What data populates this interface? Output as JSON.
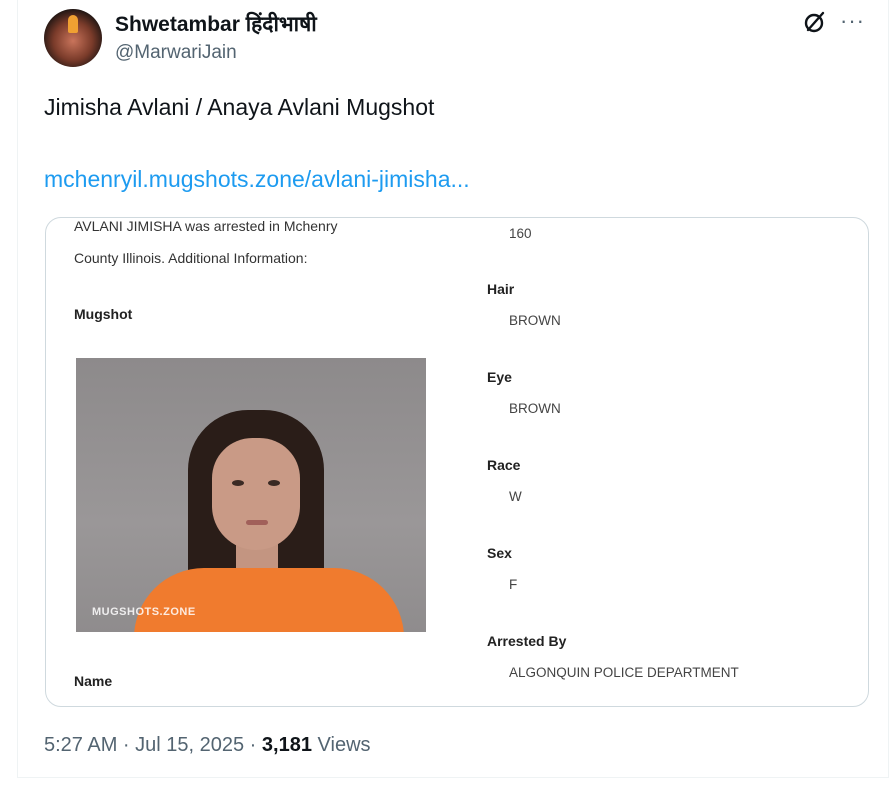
{
  "author": {
    "display_name": "Shwetambar हिंदीभाषी",
    "handle": "@MarwariJain"
  },
  "icons": {
    "grok": "grok-icon",
    "more": "more-icon",
    "more_glyph": "···"
  },
  "tweet": {
    "text": "Jimisha Avlani / Anaya Avlani Mugshot",
    "link_text": "mchenryil.mugshots.zone/avlani-jimisha..."
  },
  "card": {
    "intro_line1": "AVLANI JIMISHA was arrested in Mchenry",
    "intro_line2": "County Illinois. Additional Information:",
    "mugshot_heading": "Mugshot",
    "mugshot_watermark": "MUGSHOTS.ZONE",
    "name_heading": "Name",
    "weight_value": "160",
    "fields": [
      {
        "label": "Hair",
        "value": "BROWN"
      },
      {
        "label": "Eye",
        "value": "BROWN"
      },
      {
        "label": "Race",
        "value": "W"
      },
      {
        "label": "Sex",
        "value": "F"
      },
      {
        "label": "Arrested By",
        "value": "ALGONQUIN POLICE DEPARTMENT"
      }
    ]
  },
  "meta": {
    "timestamp": "5:27 AM · Jul 15, 2025 · ",
    "views_count": "3,181",
    "views_label": " Views"
  },
  "colors": {
    "link": "#1d9bf0",
    "secondary_text": "#536471",
    "primary_text": "#0f1419",
    "card_border": "#cfd9de",
    "prison_shirt": "#f07b2e"
  }
}
